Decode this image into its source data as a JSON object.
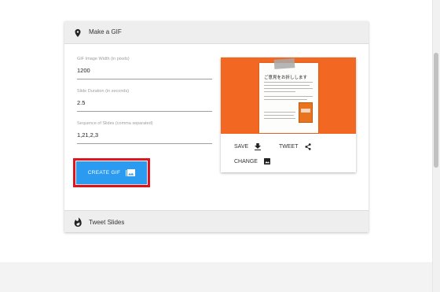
{
  "panel": {
    "header_title": "Make a GIF",
    "footer_title": "Tweet Slides"
  },
  "form": {
    "width": {
      "label": "GIF Image Width (in pixels)",
      "value": "1200"
    },
    "duration": {
      "label": "Slide Duration (in seconds)",
      "value": "2.5"
    },
    "sequence": {
      "label": "Sequence of Slides (comma separated)",
      "value": "1,21,2,3"
    }
  },
  "create_button": {
    "label": "CREATE GIF"
  },
  "card": {
    "slide_title": "ご意見をお折しします",
    "save_label": "SAVE",
    "tweet_label": "TWEET",
    "change_label": "CHANGE"
  },
  "colors": {
    "accent": "#2a9bf0",
    "highlight": "#e0151d",
    "slide_background": "#f26822"
  },
  "icons": {
    "header": "place-icon",
    "footer": "fire-icon",
    "create": "image-library-icon",
    "save": "download-icon",
    "tweet": "share-icon",
    "change": "image-icon"
  }
}
